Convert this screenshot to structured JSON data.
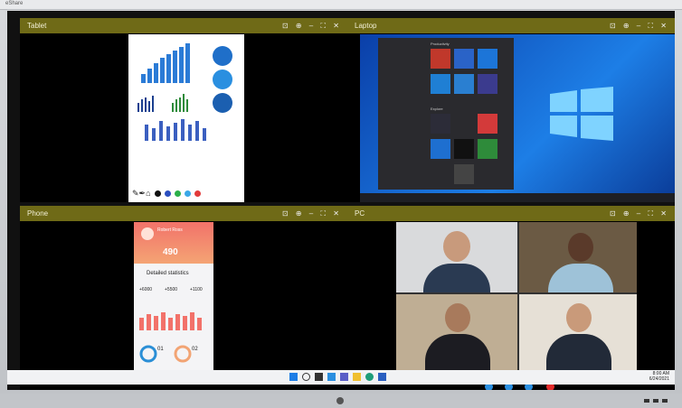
{
  "top_title": "eShare",
  "panes": {
    "tablet": {
      "title": "Tablet"
    },
    "laptop": {
      "title": "Laptop"
    },
    "phone": {
      "title": "Phone"
    },
    "pc": {
      "title": "PC"
    }
  },
  "pane_controls": "⊡ ⊕ – ⛶ ✕",
  "phone_app": {
    "user_name": "Robert Ross",
    "value": "490",
    "section_title": "Detailed statistics",
    "stats": [
      "+6000",
      "+5500",
      "+1100"
    ],
    "pct_a": "01",
    "pct_b": "02"
  },
  "laptop_menu": {
    "section_productivity": "Productivity",
    "section_explore": "Explore"
  },
  "clock": {
    "time": "8:00 AM",
    "date": "6/24/2021"
  },
  "colors": {
    "bar": "#6f6a17",
    "accent": "#1d7ee6",
    "phone_accent": "#f2726a"
  }
}
